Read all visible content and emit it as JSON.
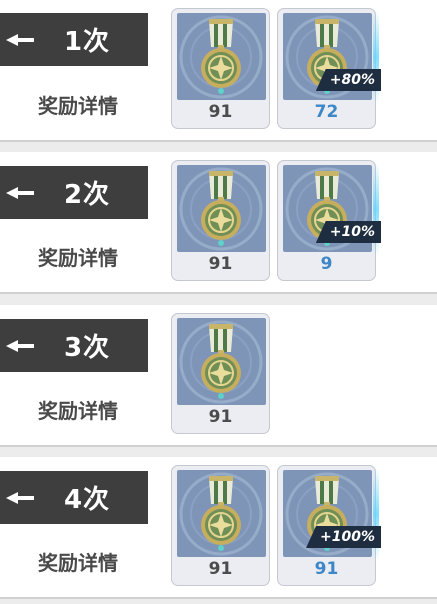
{
  "rounds": [
    {
      "times_label": "1次",
      "detail_label": "奖励详情",
      "rewards": [
        {
          "icon": "medal-icon",
          "quantity": "91",
          "bonus": false,
          "badge": ""
        },
        {
          "icon": "medal-icon",
          "quantity": "72",
          "bonus": true,
          "badge": "+80%"
        }
      ]
    },
    {
      "times_label": "2次",
      "detail_label": "奖励详情",
      "rewards": [
        {
          "icon": "medal-icon",
          "quantity": "91",
          "bonus": false,
          "badge": ""
        },
        {
          "icon": "medal-icon",
          "quantity": "9",
          "bonus": true,
          "badge": "+10%"
        }
      ]
    },
    {
      "times_label": "3次",
      "detail_label": "奖励详情",
      "rewards": [
        {
          "icon": "medal-icon",
          "quantity": "91",
          "bonus": false,
          "badge": ""
        }
      ]
    },
    {
      "times_label": "4次",
      "detail_label": "奖励详情",
      "rewards": [
        {
          "icon": "medal-icon",
          "quantity": "91",
          "bonus": false,
          "badge": ""
        },
        {
          "icon": "medal-icon",
          "quantity": "91",
          "bonus": true,
          "badge": "+100%"
        }
      ]
    }
  ],
  "colors": {
    "tag_bg": "#3e3e3e",
    "bonus_text": "#3d86c8",
    "card_art_bg": "#7e95b8"
  }
}
